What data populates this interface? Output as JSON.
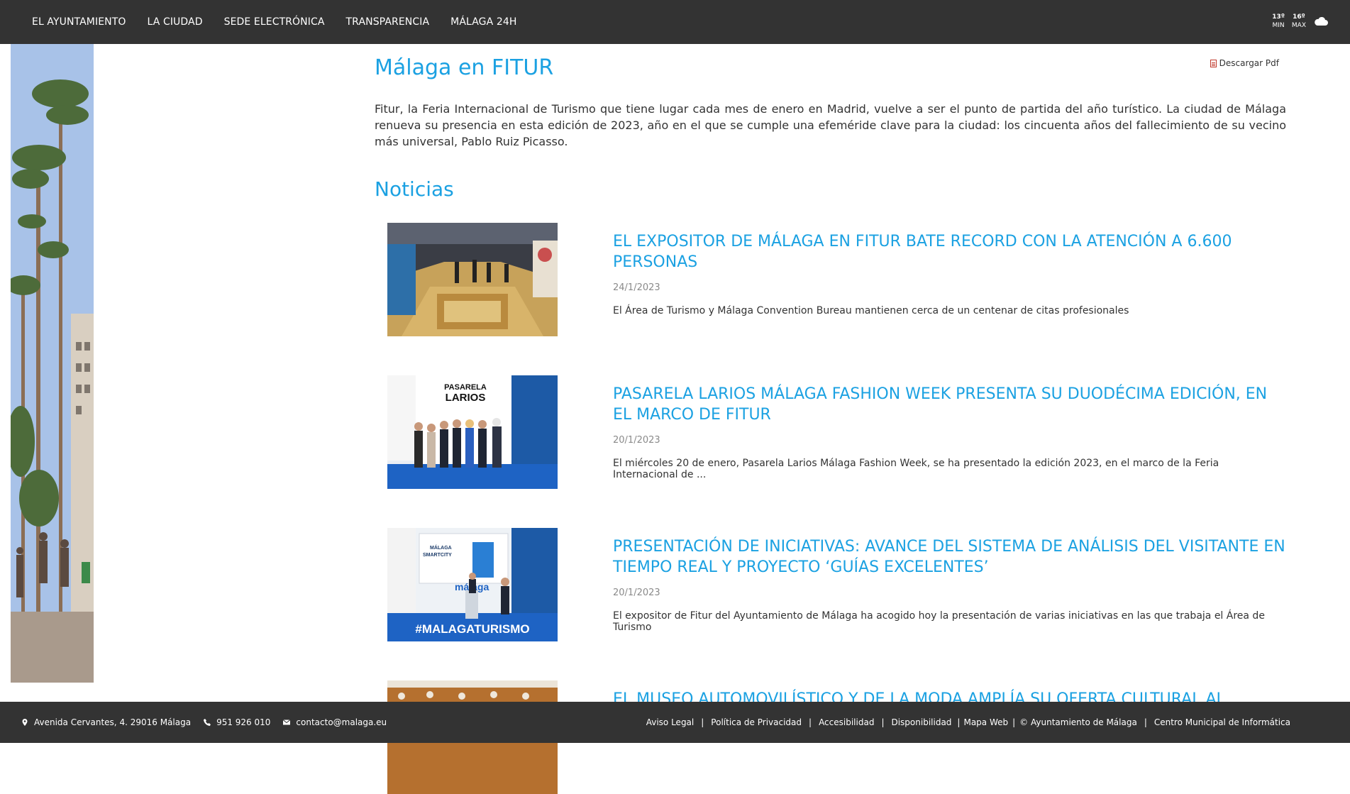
{
  "nav": {
    "items": [
      "EL AYUNTAMIENTO",
      "LA CIUDAD",
      "SEDE ELECTRÓNICA",
      "TRANSPARENCIA",
      "MÁLAGA 24H"
    ]
  },
  "weather": {
    "min_value": "13º",
    "min_label": "MIN",
    "max_value": "16º",
    "max_label": "MAX",
    "icon": "cloud-icon"
  },
  "page": {
    "title": "Málaga en FITUR",
    "pdf_label": "Descargar Pdf",
    "intro": "Fitur, la Feria Internacional de Turismo que tiene lugar cada mes de enero en Madrid, vuelve a ser el punto de partida del año turístico. La ciudad de Málaga renueva su presencia en esta edición de 2023, año en el que se cumple una efeméride clave para la ciudad: los cincuenta años del fallecimiento de su vecino más universal, Pablo Ruiz Picasso.",
    "section_title": "Noticias"
  },
  "news": [
    {
      "headline": "EL EXPOSITOR DE MÁLAGA EN FITUR BATE RECORD CON LA ATENCIÓN A 6.600 PERSONAS",
      "date": "24/1/2023",
      "summary": "El Área de Turismo y Málaga Convention Bureau mantienen cerca de un centenar de citas profesionales"
    },
    {
      "headline": "PASARELA LARIOS MÁLAGA FASHION WEEK PRESENTA SU DUODÉCIMA EDICIÓN, EN EL MARCO DE FITUR",
      "date": "20/1/2023",
      "summary": "El miércoles 20 de enero, Pasarela Larios Málaga Fashion Week, se ha presentado la edición 2023, en el marco de la Feria Internacional de ...",
      "thumb_text": [
        "PASARELA",
        "LARIOS"
      ]
    },
    {
      "headline": "PRESENTACIÓN DE INICIATIVAS: AVANCE DEL SISTEMA DE ANÁLISIS DEL VISITANTE EN TIEMPO REAL Y PROYECTO ‘GUÍAS EXCELENTES’",
      "date": "20/1/2023",
      "summary": "El expositor de Fitur del Ayuntamiento de Málaga ha acogido hoy la presentación de varias iniciativas en las que trabaja el Área de Turismo",
      "thumb_text": [
        "MÁLAGA",
        "SMARTCITY",
        "málaga",
        "#MALAGATURISMO"
      ]
    },
    {
      "headline": "EL MUSEO AUTOMOVILÍSTICO Y DE LA MODA AMPLÍA SU OFERTA CULTURAL AL",
      "date": "",
      "summary": ""
    }
  ],
  "footer": {
    "address": "Avenida Cervantes, 4. 29016 Málaga",
    "phone": "951 926 010",
    "email": "contacto@malaga.eu",
    "links": [
      "Aviso Legal",
      "Política de Privacidad",
      "Accesibilidad",
      "Disponibilidad",
      "Mapa Web",
      "© Ayuntamiento de Málaga",
      "Centro Municipal de Informática"
    ]
  },
  "colors": {
    "bar": "#333333",
    "accent": "#1ba1e2",
    "text": "#333333",
    "date": "#8a8a8a"
  }
}
